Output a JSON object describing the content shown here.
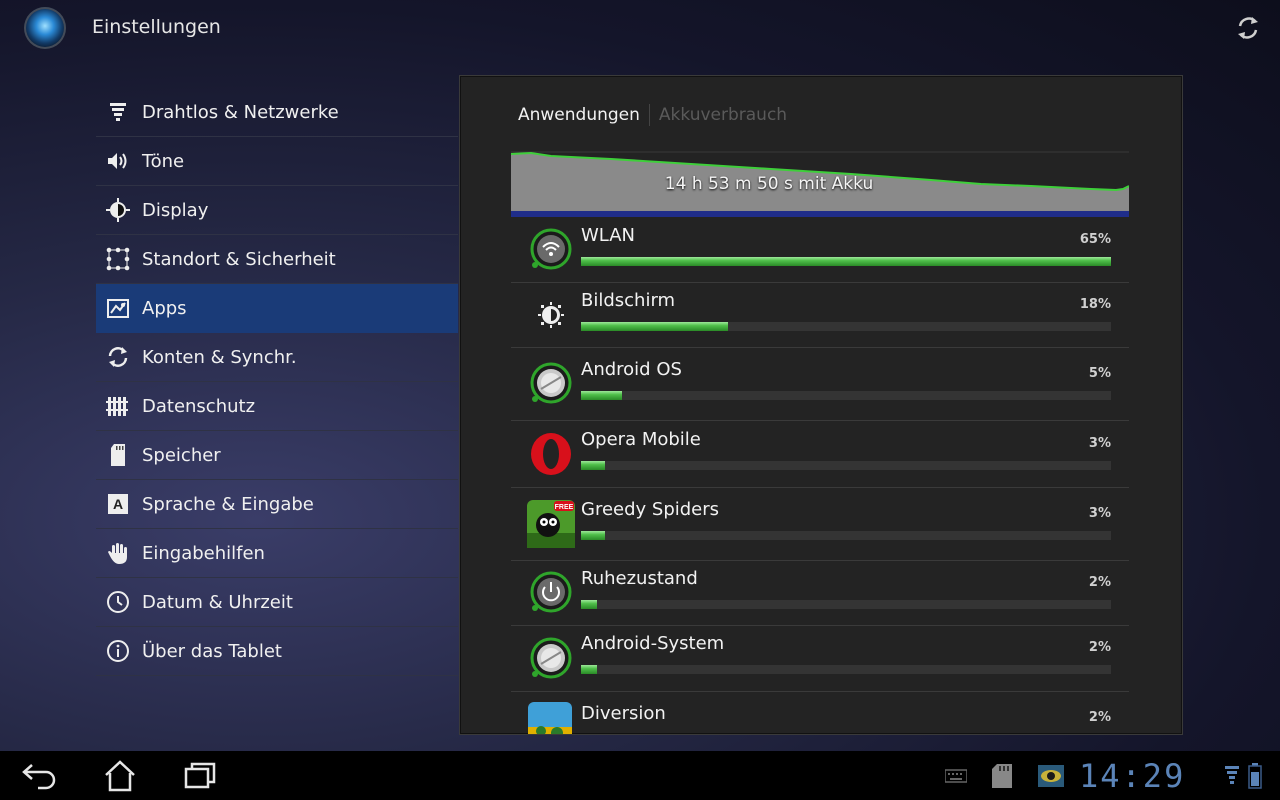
{
  "app": {
    "title": "Einstellungen"
  },
  "nav": {
    "items": [
      {
        "label": "Drahtlos & Netzwerke",
        "icon": "wifi-signal-icon"
      },
      {
        "label": "Töne",
        "icon": "speaker-icon"
      },
      {
        "label": "Display",
        "icon": "brightness-icon"
      },
      {
        "label": "Standort & Sicherheit",
        "icon": "location-grid-icon"
      },
      {
        "label": "Apps",
        "icon": "apps-icon",
        "active": true
      },
      {
        "label": "Konten & Synchr.",
        "icon": "sync-icon"
      },
      {
        "label": "Datenschutz",
        "icon": "privacy-fence-icon"
      },
      {
        "label": "Speicher",
        "icon": "sd-card-icon"
      },
      {
        "label": "Sprache & Eingabe",
        "icon": "keyboard-a-icon"
      },
      {
        "label": "Eingabehilfen",
        "icon": "hand-icon"
      },
      {
        "label": "Datum & Uhrzeit",
        "icon": "clock-icon"
      },
      {
        "label": "Über das Tablet",
        "icon": "info-icon"
      }
    ]
  },
  "panel": {
    "tabs": [
      {
        "label": "Anwendungen",
        "active": true
      },
      {
        "label": "Akkuverbrauch",
        "active": false
      }
    ],
    "graph": {
      "label": "14 h 53 m 50 s mit Akku"
    },
    "apps": [
      {
        "name": "WLAN",
        "percent_label": "65%",
        "value": 0.65,
        "icon": "wifi-app-icon"
      },
      {
        "name": "Bildschirm",
        "percent_label": "18%",
        "value": 0.18,
        "icon": "screen-brightness-icon"
      },
      {
        "name": "Android OS",
        "percent_label": "5%",
        "value": 0.05,
        "icon": "android-os-icon"
      },
      {
        "name": "Opera Mobile",
        "percent_label": "3%",
        "value": 0.03,
        "icon": "opera-icon"
      },
      {
        "name": "Greedy Spiders",
        "percent_label": "3%",
        "value": 0.03,
        "icon": "greedy-spiders-icon",
        "badge": "FREE"
      },
      {
        "name": "Ruhezustand",
        "percent_label": "2%",
        "value": 0.02,
        "icon": "power-icon"
      },
      {
        "name": "Android-System",
        "percent_label": "2%",
        "value": 0.02,
        "icon": "android-system-icon"
      },
      {
        "name": "Diversion",
        "percent_label": "2%",
        "value": 0.02,
        "icon": "diversion-icon"
      }
    ]
  },
  "status": {
    "clock": "14:29"
  },
  "colors": {
    "accent_bar": "#4fbf4a",
    "selected": "#1a3b78",
    "clock": "#5b84b8"
  }
}
